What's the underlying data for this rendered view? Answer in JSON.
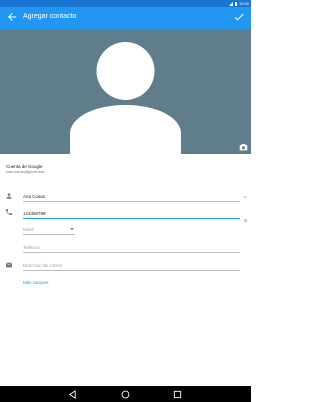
{
  "status_bar": {
    "time": "10:00"
  },
  "app_bar": {
    "title": "Agregar contacto"
  },
  "account": {
    "title": "Cuenta de Google",
    "email": "juan.ruiz.sm@gmail.com"
  },
  "form": {
    "name_value": "Ana Cosas",
    "phone_value": "123456789",
    "phone_type_label": "Móvil",
    "phone2_placeholder": "Teléfono",
    "email_placeholder": "Dirección de correo",
    "more_fields": "Más campos"
  },
  "colors": {
    "app_bar": "#2196f3",
    "status_bar": "#1976d2",
    "photo_bg": "#607d8b",
    "accent": "#2196f3"
  }
}
